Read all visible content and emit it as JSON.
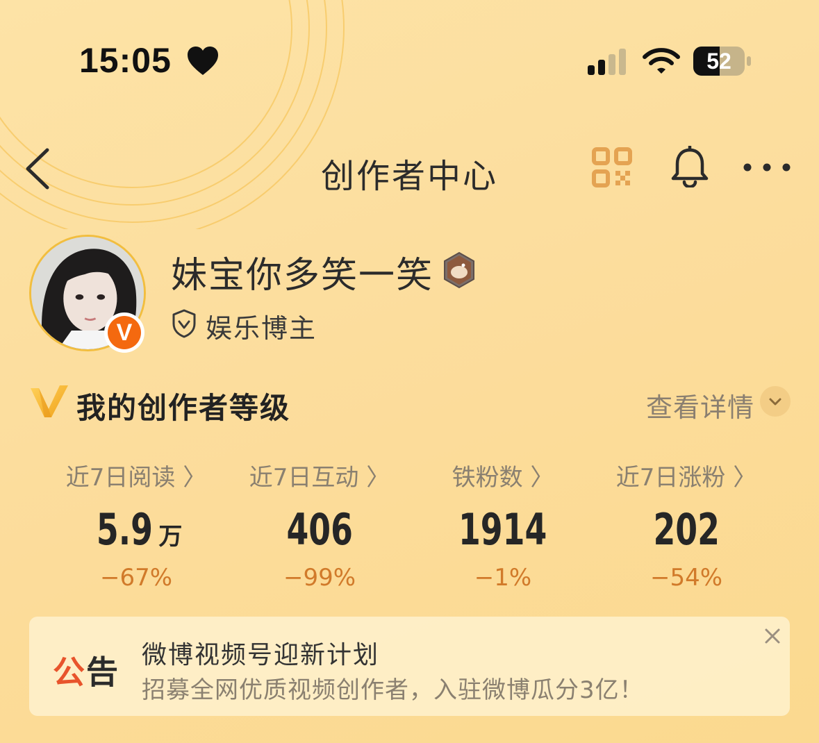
{
  "status_bar": {
    "time": "15:05",
    "battery": "52",
    "battery_level": 0.52
  },
  "nav": {
    "title": "创作者中心"
  },
  "profile": {
    "name": "妹宝你多笑一笑",
    "category": "娱乐博主",
    "badge_letter": "V"
  },
  "level_section": {
    "title": "我的创作者等级",
    "detail_label": "查看详情"
  },
  "stats": [
    {
      "label": "近7日阅读 〉",
      "value": "5.9",
      "unit": "万",
      "change": "−67%"
    },
    {
      "label": "近7日互动 〉",
      "value": "406",
      "unit": "",
      "change": "−99%"
    },
    {
      "label": "铁粉数 〉",
      "value": "1914",
      "unit": "",
      "change": "−1%"
    },
    {
      "label": "近7日涨粉 〉",
      "value": "202",
      "unit": "",
      "change": "−54%"
    }
  ],
  "notice": {
    "label_a": "公",
    "label_b": "告",
    "title": "微博视频号迎新计划",
    "description": "招募全网优质视频创作者，入驻微博瓜分3亿！"
  },
  "colors": {
    "accent": "#f4690f",
    "change": "#d17a2a",
    "background": "#fcdd9d"
  }
}
